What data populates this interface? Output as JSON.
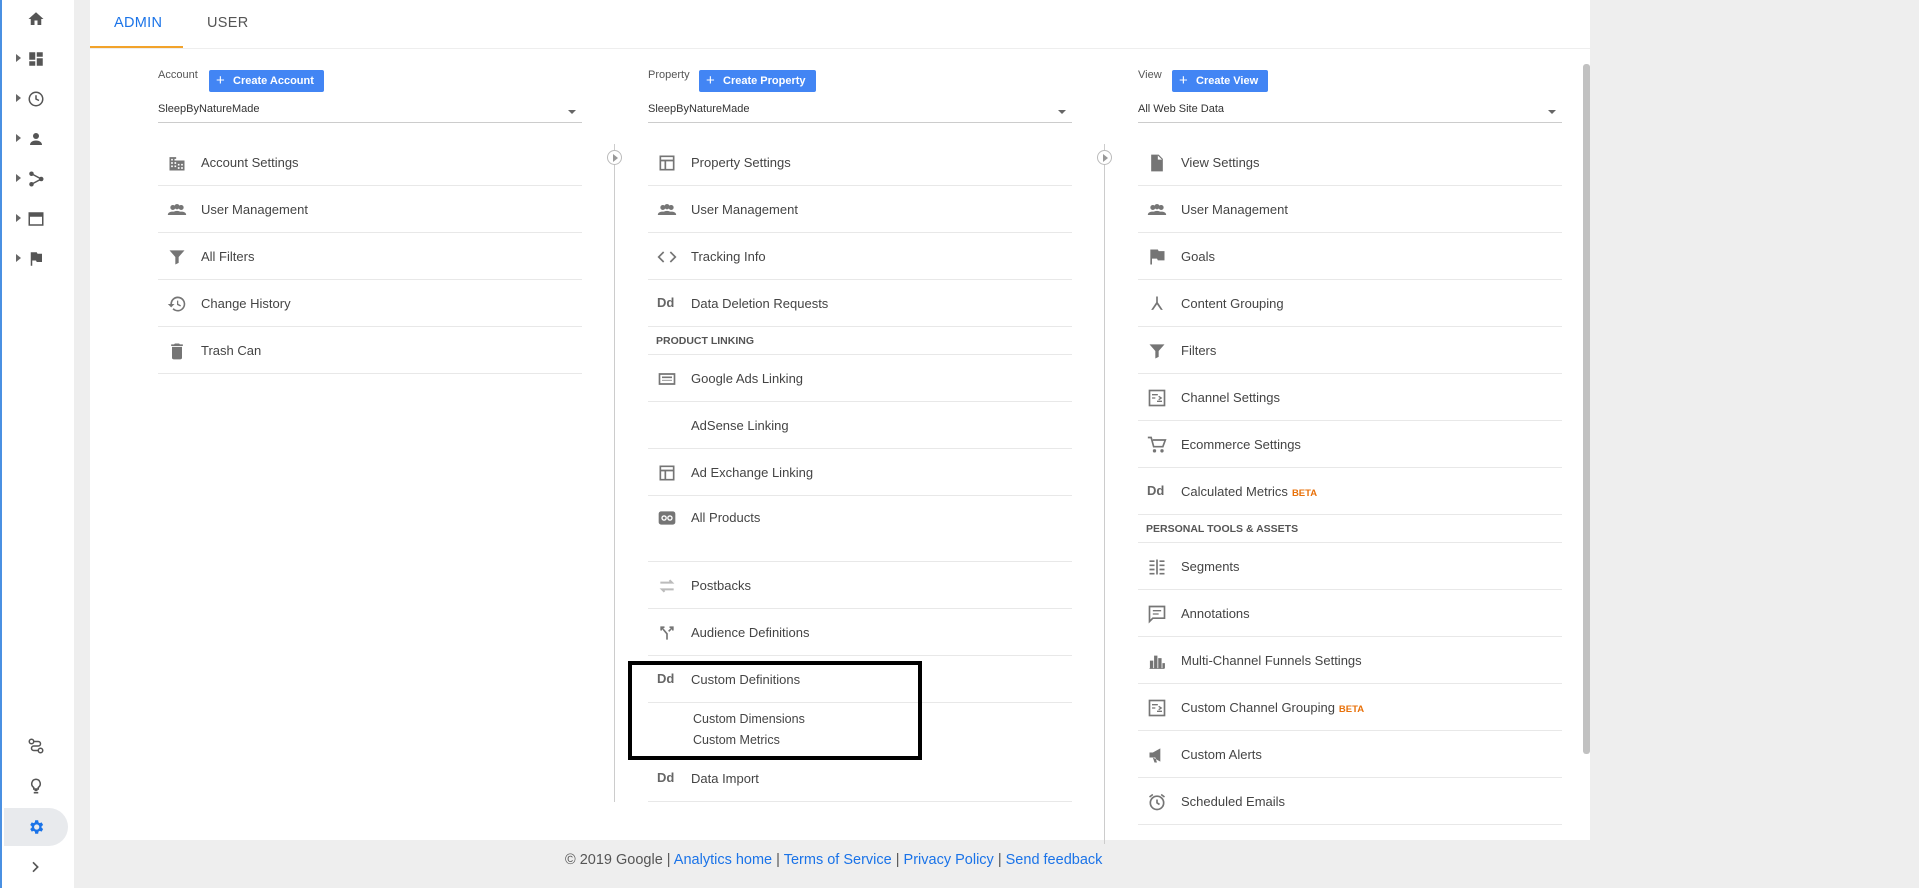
{
  "nav": {
    "items": [
      {
        "icon": "home-icon",
        "caret": false
      },
      {
        "icon": "customization-icon",
        "caret": true
      },
      {
        "icon": "realtime-clock-icon",
        "caret": true
      },
      {
        "icon": "audience-person-icon",
        "caret": true
      },
      {
        "icon": "acquisition-icon",
        "caret": true
      },
      {
        "icon": "behavior-icon",
        "caret": true
      },
      {
        "icon": "conversions-flag-icon",
        "caret": true
      }
    ],
    "bottom": [
      {
        "icon": "attribution-icon"
      },
      {
        "icon": "discover-lightbulb-icon"
      },
      {
        "icon": "admin-gear-icon",
        "active": true
      },
      {
        "icon": "expand-chevron-icon"
      }
    ]
  },
  "tabs": {
    "admin": "ADMIN",
    "user": "USER"
  },
  "account": {
    "label": "Account",
    "button": "Create Account",
    "selected": "SleepByNatureMade",
    "items": [
      {
        "label": "Account Settings",
        "icon": "building-icon"
      },
      {
        "label": "User Management",
        "icon": "people-icon"
      },
      {
        "label": "All Filters",
        "icon": "filter-icon"
      },
      {
        "label": "Change History",
        "icon": "history-icon"
      },
      {
        "label": "Trash Can",
        "icon": "trash-icon"
      }
    ]
  },
  "property": {
    "label": "Property",
    "button": "Create Property",
    "selected": "SleepByNatureMade",
    "items": [
      {
        "label": "Property Settings",
        "icon": "layout-icon"
      },
      {
        "label": "User Management",
        "icon": "people-icon"
      },
      {
        "label": "Tracking Info",
        "icon": "code-icon"
      },
      {
        "label": "Data Deletion Requests",
        "icon": "dd-icon"
      }
    ],
    "section": "PRODUCT LINKING",
    "linking": [
      {
        "label": "Google Ads Linking",
        "icon": "ads-icon"
      },
      {
        "label": "AdSense Linking",
        "icon": ""
      },
      {
        "label": "Ad Exchange Linking",
        "icon": "layout-icon"
      },
      {
        "label": "All Products",
        "icon": "link-icon"
      }
    ],
    "more": [
      {
        "label": "Postbacks",
        "icon": "postback-icon"
      },
      {
        "label": "Audience Definitions",
        "icon": "fork-icon"
      },
      {
        "label": "Custom Definitions",
        "icon": "dd-icon"
      }
    ],
    "subitems": [
      "Custom Dimensions",
      "Custom Metrics"
    ],
    "last": {
      "label": "Data Import",
      "icon": "dd-icon"
    }
  },
  "view": {
    "label": "View",
    "button": "Create View",
    "selected": "All Web Site Data",
    "items": [
      {
        "label": "View Settings",
        "icon": "document-icon"
      },
      {
        "label": "User Management",
        "icon": "people-icon"
      },
      {
        "label": "Goals",
        "icon": "flag-icon"
      },
      {
        "label": "Content Grouping",
        "icon": "grouping-icon"
      },
      {
        "label": "Filters",
        "icon": "filter-icon"
      },
      {
        "label": "Channel Settings",
        "icon": "channel-icon"
      },
      {
        "label": "Ecommerce Settings",
        "icon": "cart-icon"
      },
      {
        "label": "Calculated Metrics",
        "icon": "dd-icon",
        "badge": "BETA"
      }
    ],
    "section": "PERSONAL TOOLS & ASSETS",
    "tools": [
      {
        "label": "Segments",
        "icon": "segments-icon"
      },
      {
        "label": "Annotations",
        "icon": "comment-icon"
      },
      {
        "label": "Multi-Channel Funnels Settings",
        "icon": "bar-chart-icon"
      },
      {
        "label": "Custom Channel Grouping",
        "icon": "channel-icon",
        "badge": "BETA"
      },
      {
        "label": "Custom Alerts",
        "icon": "megaphone-icon"
      },
      {
        "label": "Scheduled Emails",
        "icon": "alarm-icon"
      }
    ]
  },
  "footer": {
    "copyright": "© 2019 Google |",
    "analytics_home": "Analytics home",
    "sep": "|",
    "terms": "Terms of Service",
    "privacy": "Privacy Policy",
    "feedback": "Send feedback"
  },
  "colors": {
    "accent": "#4285f4",
    "tab_active": "#1a73e8",
    "underline": "#f2a32b",
    "beta": "#e8710a"
  }
}
